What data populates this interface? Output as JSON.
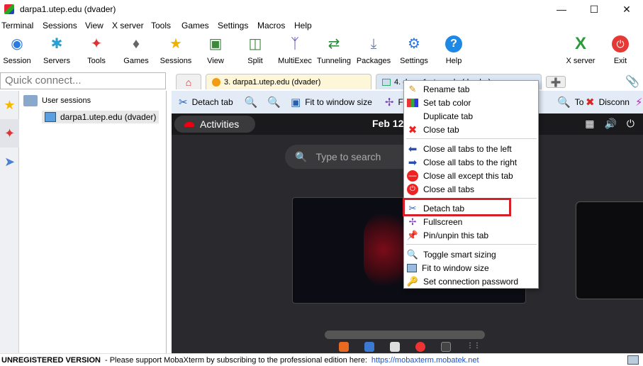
{
  "window": {
    "title": "darpa1.utep.edu (dvader)"
  },
  "menu": [
    "Terminal",
    "Sessions",
    "View",
    "X server",
    "Tools",
    "Games",
    "Settings",
    "Macros",
    "Help"
  ],
  "toolbar": [
    {
      "label": "Session"
    },
    {
      "label": "Servers"
    },
    {
      "label": "Tools"
    },
    {
      "label": "Games"
    },
    {
      "label": "Sessions"
    },
    {
      "label": "View"
    },
    {
      "label": "Split"
    },
    {
      "label": "MultiExec"
    },
    {
      "label": "Tunneling"
    },
    {
      "label": "Packages"
    },
    {
      "label": "Settings"
    },
    {
      "label": "Help"
    },
    {
      "label": "X server"
    },
    {
      "label": "Exit"
    }
  ],
  "quick_connect": {
    "placeholder": "Quick connect..."
  },
  "tabs": [
    {
      "label": "3. darpa1.utep.edu (dvader)"
    },
    {
      "label": "4. darpa1.utep.edu (dvader)"
    }
  ],
  "sidebar": {
    "root": "User sessions",
    "child": "darpa1.utep.edu (dvader)"
  },
  "session_toolbar": {
    "detach": "Detach tab",
    "fit": "Fit to window size",
    "full": "Ful",
    "toggle": "To",
    "disconnect": "Disconn"
  },
  "remote": {
    "activities": "Activities",
    "clock": "Feb 12",
    "search_placeholder": "Type to search"
  },
  "context_menu": {
    "items": [
      {
        "label": "Rename tab"
      },
      {
        "label": "Set tab color"
      },
      {
        "label": "Duplicate tab"
      },
      {
        "label": "Close tab"
      },
      {
        "label": "Close all tabs to the left"
      },
      {
        "label": "Close all tabs to the right"
      },
      {
        "label": "Close all except this tab"
      },
      {
        "label": "Close all tabs"
      },
      {
        "label": "Detach tab"
      },
      {
        "label": "Fullscreen"
      },
      {
        "label": "Pin/unpin this tab"
      },
      {
        "label": "Toggle smart sizing"
      },
      {
        "label": "Fit to window size"
      },
      {
        "label": "Set connection password"
      }
    ]
  },
  "status": {
    "unregistered": "UNREGISTERED VERSION",
    "message": "-  Please support MobaXterm by subscribing to the professional edition here:",
    "link": "https://mobaxterm.mobatek.net"
  }
}
